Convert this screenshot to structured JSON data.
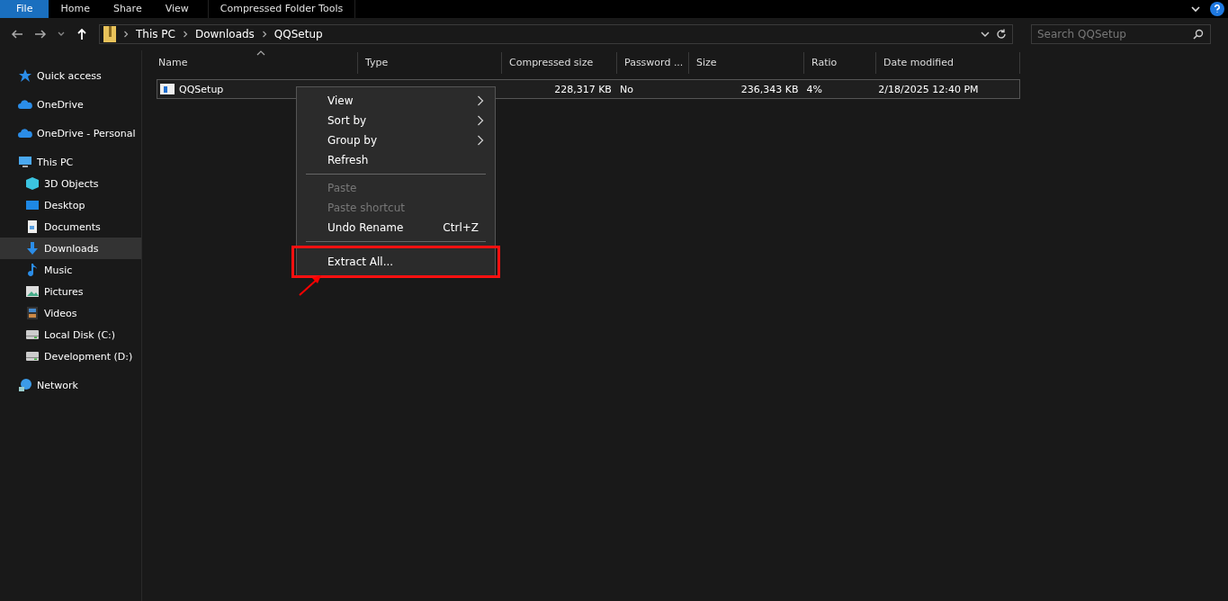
{
  "ribbon": {
    "tabs": [
      {
        "label": "File",
        "selected": true
      },
      {
        "label": "Home",
        "selected": false
      },
      {
        "label": "Share",
        "selected": false
      },
      {
        "label": "View",
        "selected": false
      },
      {
        "label": "Compressed Folder Tools",
        "selected": false
      }
    ]
  },
  "address": {
    "crumbs": [
      "This PC",
      "Downloads",
      "QQSetup"
    ]
  },
  "search": {
    "placeholder": "Search QQSetup"
  },
  "sidebar": {
    "items": [
      {
        "label": "Quick access",
        "kind": "star",
        "selected": false
      },
      {
        "label": "OneDrive",
        "kind": "cloud",
        "selected": false
      },
      {
        "label": "OneDrive - Personal",
        "kind": "cloud",
        "selected": false
      },
      {
        "label": "This PC",
        "kind": "pc",
        "selected": false,
        "children": [
          {
            "label": "3D Objects",
            "kind": "cube",
            "selected": false
          },
          {
            "label": "Desktop",
            "kind": "desktop",
            "selected": false
          },
          {
            "label": "Documents",
            "kind": "document",
            "selected": false
          },
          {
            "label": "Downloads",
            "kind": "download",
            "selected": true
          },
          {
            "label": "Music",
            "kind": "music",
            "selected": false
          },
          {
            "label": "Pictures",
            "kind": "pictures",
            "selected": false
          },
          {
            "label": "Videos",
            "kind": "videos",
            "selected": false
          },
          {
            "label": "Local Disk (C:)",
            "kind": "drive",
            "selected": false
          },
          {
            "label": "Development (D:)",
            "kind": "drive",
            "selected": false
          }
        ]
      },
      {
        "label": "Network",
        "kind": "network",
        "selected": false
      }
    ]
  },
  "table": {
    "columns": [
      "Name",
      "Type",
      "Compressed size",
      "Password ...",
      "Size",
      "Ratio",
      "Date modified"
    ],
    "rows": [
      {
        "selected": true,
        "cells": [
          "QQSetup",
          "",
          "228,317 KB",
          "No",
          "236,343 KB",
          "4%",
          "2/18/2025 12:40 PM"
        ]
      }
    ]
  },
  "context_menu": {
    "items": [
      {
        "kind": "item",
        "label": "View",
        "submenu": true,
        "disabled": false,
        "highlighted": false
      },
      {
        "kind": "item",
        "label": "Sort by",
        "submenu": true,
        "disabled": false,
        "highlighted": false
      },
      {
        "kind": "item",
        "label": "Group by",
        "submenu": true,
        "disabled": false,
        "highlighted": false
      },
      {
        "kind": "item",
        "label": "Refresh",
        "submenu": false,
        "disabled": false,
        "highlighted": false
      },
      {
        "kind": "separator"
      },
      {
        "kind": "item",
        "label": "Paste",
        "submenu": false,
        "disabled": true,
        "highlighted": false
      },
      {
        "kind": "item",
        "label": "Paste shortcut",
        "submenu": false,
        "disabled": true,
        "highlighted": false
      },
      {
        "kind": "item",
        "label": "Undo Rename",
        "shortcut": "Ctrl+Z",
        "submenu": false,
        "disabled": false,
        "highlighted": false
      },
      {
        "kind": "separator"
      },
      {
        "kind": "item",
        "label": "Extract All...",
        "submenu": false,
        "disabled": false,
        "highlighted": true
      }
    ]
  }
}
